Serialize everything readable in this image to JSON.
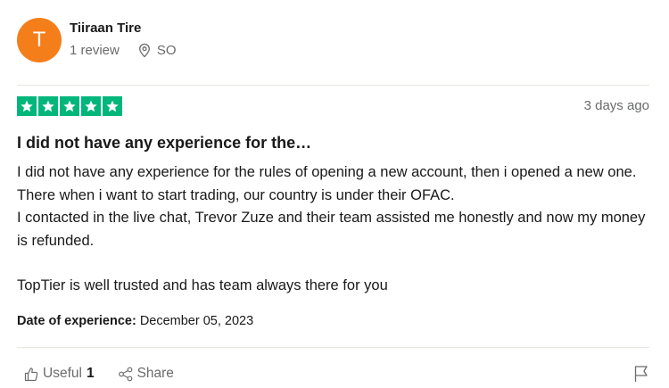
{
  "consumer": {
    "avatar_letter": "T",
    "name": "Tiiraan Tire",
    "reviews": "1 review",
    "country": "SO"
  },
  "review": {
    "rating": 5,
    "date_ago": "3 days ago",
    "title": "I did not have any experience for the…",
    "paragraphs": [
      "I did not have any experience for the rules of opening a new account, then i opened a new one. There when i want to start trading, our country is under their OFAC.",
      "I contacted in the live chat, Trevor Zuze and their team assisted me honestly and now my money is refunded.",
      "TopTier is well trusted and has team always there for you"
    ],
    "experience_label": "Date of experience:",
    "experience_date": "December 05, 2023"
  },
  "actions": {
    "useful_label": "Useful",
    "useful_count": "1",
    "share_label": "Share"
  },
  "colors": {
    "avatar": "#f47e1a",
    "star": "#00b67a",
    "muted_text": "#696a6a"
  },
  "icons": {
    "location": "location-pin-icon",
    "thumbs_up": "thumbs-up-icon",
    "share": "share-icon",
    "flag": "flag-icon",
    "star": "star-icon"
  }
}
